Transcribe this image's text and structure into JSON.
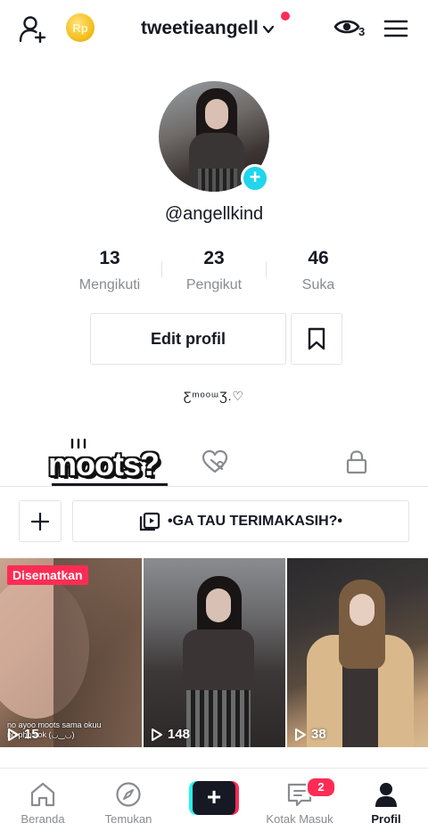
{
  "header": {
    "coin_label": "Rp",
    "username": "tweetieangell",
    "profile_views_count": "3"
  },
  "profile": {
    "handle": "@angellkind",
    "stats": [
      {
        "value": "13",
        "label": "Mengikuti"
      },
      {
        "value": "23",
        "label": "Pengikut"
      },
      {
        "value": "46",
        "label": "Suka"
      }
    ],
    "edit_label": "Edit profil",
    "bio": "ƸᵐᵒᵒᵚƷ.♡"
  },
  "tabs": {
    "sticker_text": "moots?"
  },
  "playlist": {
    "label": "•GA TAU TERIMAKASIH?•"
  },
  "videos": [
    {
      "pinned_label": "Disematkan",
      "caption": "no ayoo moots sama okuu\nno php kok (◡‿◡)",
      "views": "15"
    },
    {
      "views": "148"
    },
    {
      "views": "38"
    }
  ],
  "nav": {
    "items": [
      {
        "label": "Beranda",
        "icon": "home-icon"
      },
      {
        "label": "Temukan",
        "icon": "compass-icon"
      },
      {
        "label": "Kotak Masuk",
        "icon": "inbox-icon",
        "badge": "2"
      },
      {
        "label": "Profil",
        "icon": "profile-icon"
      }
    ]
  },
  "colors": {
    "accent": "#fe2c55",
    "cyan": "#25f4ee",
    "text": "#161823",
    "muted": "#8a8b91"
  }
}
